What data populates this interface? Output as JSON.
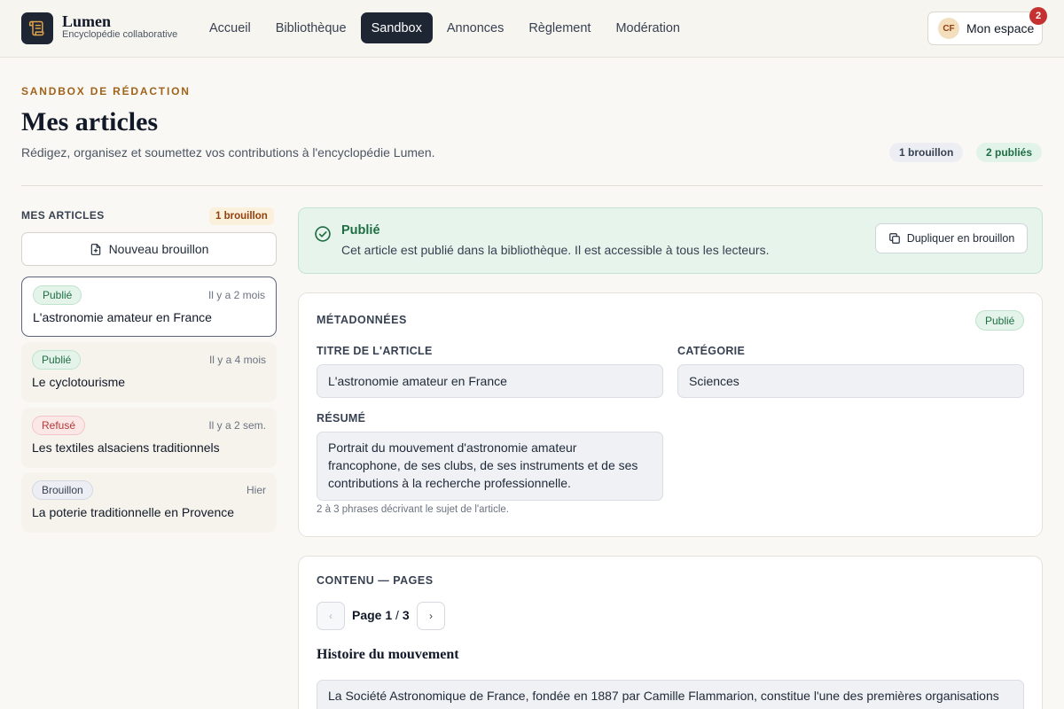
{
  "brand": {
    "name": "Lumen",
    "subtitle": "Encyclopédie collaborative",
    "logo_icon": "scroll-icon"
  },
  "nav": [
    {
      "label": "Accueil",
      "active": false
    },
    {
      "label": "Bibliothèque",
      "active": false
    },
    {
      "label": "Sandbox",
      "active": true
    },
    {
      "label": "Annonces",
      "active": false
    },
    {
      "label": "Règlement",
      "active": false
    },
    {
      "label": "Modération",
      "active": false
    }
  ],
  "account": {
    "initials": "CF",
    "label": "Mon espace",
    "notifications": "2"
  },
  "page": {
    "eyebrow": "SANDBOX DE RÉDACTION",
    "title": "Mes articles",
    "subtitle": "Rédigez, organisez et soumettez vos contributions à l'encyclopédie Lumen.",
    "stats": {
      "drafts": "1 brouillon",
      "published": "2 publiés"
    }
  },
  "sidebar": {
    "title": "MES ARTICLES",
    "count": "1 brouillon",
    "new_button": "Nouveau brouillon",
    "articles": [
      {
        "status": "Publié",
        "time": "Il y a 2 mois",
        "title": "L'astronomie amateur en France"
      },
      {
        "status": "Publié",
        "time": "Il y a 4 mois",
        "title": "Le cyclotourisme"
      },
      {
        "status": "Refusé",
        "time": "Il y a 2 sem.",
        "title": "Les textiles alsaciens traditionnels"
      },
      {
        "status": "Brouillon",
        "time": "Hier",
        "title": "La poterie traditionnelle en Provence"
      }
    ]
  },
  "banner": {
    "title": "Publié",
    "text": "Cet article est publié dans la bibliothèque. Il est accessible à tous les lecteurs.",
    "button": "Dupliquer en brouillon"
  },
  "metadata": {
    "title": "MÉTADONNÉES",
    "status": "Publié",
    "title_label": "TITRE DE L'ARTICLE",
    "title_value": "L'astronomie amateur en France",
    "category_label": "CATÉGORIE",
    "category_value": "Sciences",
    "summary_label": "RÉSUMÉ",
    "summary_value": "Portrait du mouvement d'astronomie amateur francophone, de ses clubs, de ses instruments et de ses contributions à la recherche professionnelle.",
    "summary_hint": "2 à 3 phrases décrivant le sujet de l'article."
  },
  "content": {
    "title": "CONTENU — PAGES",
    "page_word": "Page",
    "current_page": "1",
    "page_sep": "/",
    "total_pages": "3",
    "prev": "‹",
    "next": "›",
    "section_title": "Histoire du mouvement",
    "text": "La Société Astronomique de France, fondée en 1887 par Camille Flammarion, constitue l'une des premières organisations"
  },
  "colors": {
    "accent_dark": "#1e2533",
    "eyebrow": "#a0631a",
    "success": "#1f6e43",
    "danger": "#b53737"
  }
}
